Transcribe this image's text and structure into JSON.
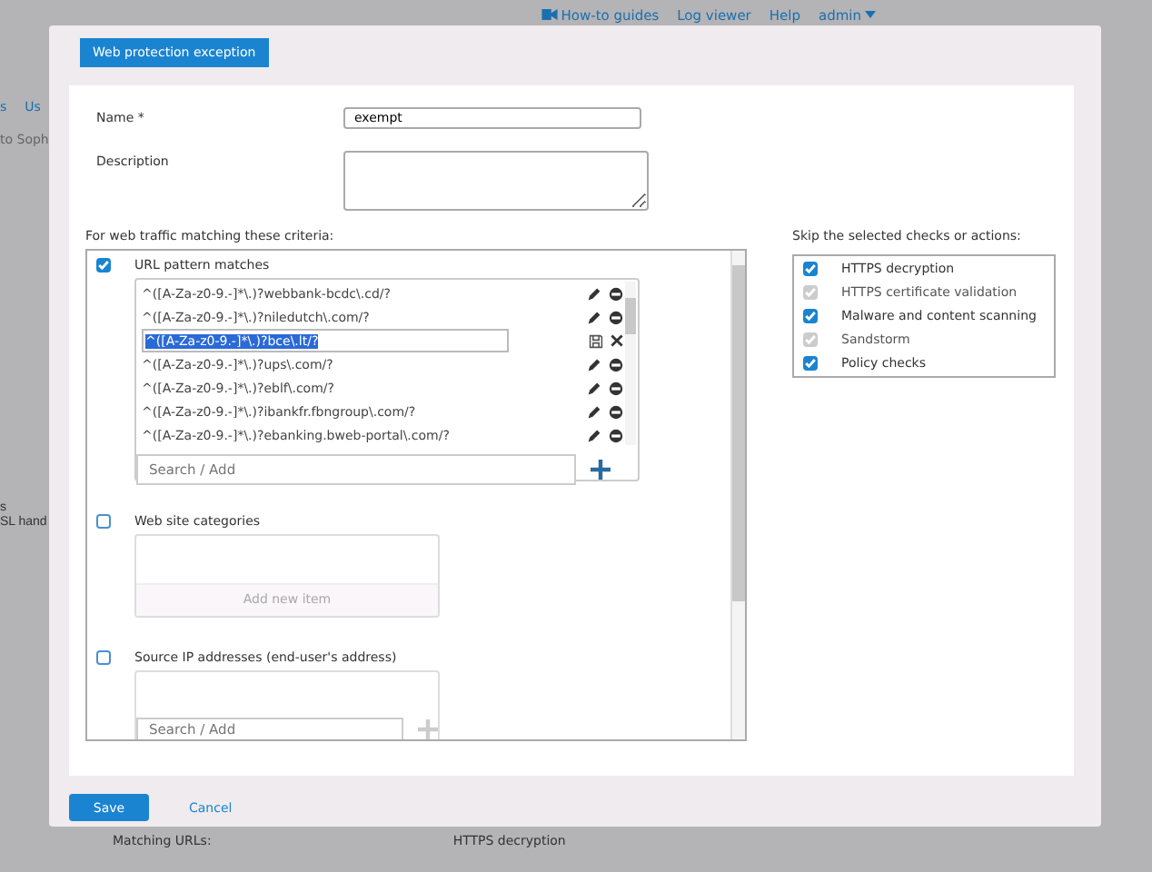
{
  "top_bar": {
    "links": [
      {
        "label": "How-to guides",
        "kind": "video"
      },
      {
        "label": "Log viewer",
        "kind": "plain"
      },
      {
        "label": "Help",
        "kind": "plain"
      },
      {
        "label": "admin",
        "kind": "menu"
      }
    ]
  },
  "background": {
    "tab_fragments": [
      "s",
      "Us"
    ],
    "intro_fragment": "to Soph",
    "side_fragments": [
      "s",
      "SL hand"
    ],
    "summary_label": "Matching URLs:",
    "summary_value": "HTTPS decryption"
  },
  "dialog": {
    "title": "Web protection exception",
    "name_field": {
      "label": "Name *",
      "value": "exempt"
    },
    "description_field": {
      "label": "Description"
    },
    "criteria_heading": "For web traffic matching these criteria:",
    "criteria": [
      {
        "kind": "urls",
        "label": "URL pattern matches",
        "checked": true,
        "patterns": [
          {
            "text": "^([A-Za-z0-9.-]*\\.)?webbank-bcdc\\.cd/?",
            "editing": false
          },
          {
            "text": "^([A-Za-z0-9.-]*\\.)?niledutch\\.com/?",
            "editing": false
          },
          {
            "text": "^([A-Za-z0-9.-]*\\.)?bce\\.lt/?",
            "editing": true
          },
          {
            "text": "^([A-Za-z0-9.-]*\\.)?ups\\.com/?",
            "editing": false
          },
          {
            "text": "^([A-Za-z0-9.-]*\\.)?eblf\\.com/?",
            "editing": false
          },
          {
            "text": "^([A-Za-z0-9.-]*\\.)?ibankfr.fbngroup\\.com/?",
            "editing": false
          },
          {
            "text": "^([A-Za-z0-9.-]*\\.)?ebanking.bweb-portal\\.com/?",
            "editing": false
          }
        ],
        "placeholder": "Search / Add"
      },
      {
        "kind": "categories",
        "label": "Web site categories",
        "checked": false,
        "add_label": "Add new item"
      },
      {
        "kind": "addresses",
        "label": "Source IP addresses (end-user's address)",
        "checked": false,
        "placeholder": "Search / Add"
      }
    ],
    "skip_heading": "Skip the selected checks or actions:",
    "skip_checks": [
      {
        "label": "HTTPS decryption",
        "checked": true,
        "disabled": false
      },
      {
        "label": "HTTPS certificate validation",
        "checked": true,
        "disabled": true
      },
      {
        "label": "Malware and content scanning",
        "checked": true,
        "disabled": false
      },
      {
        "label": "Sandstorm",
        "checked": true,
        "disabled": true
      },
      {
        "label": "Policy checks",
        "checked": true,
        "disabled": false
      }
    ],
    "buttons": {
      "save": "Save",
      "cancel": "Cancel"
    }
  }
}
